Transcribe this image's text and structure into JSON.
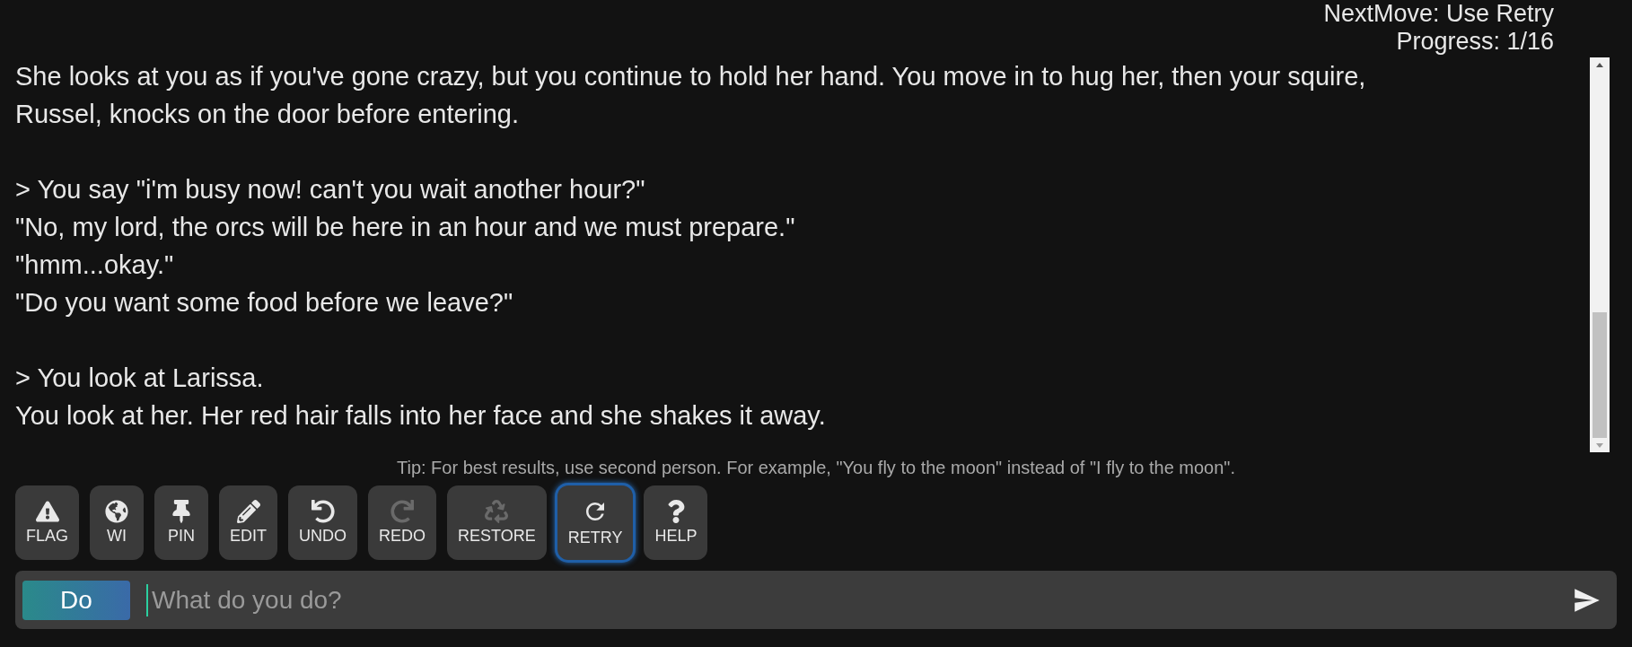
{
  "status": {
    "next_move": "NextMove: Use Retry",
    "progress": "Progress: 1/16"
  },
  "story": [
    {
      "kind": "text",
      "text": "She looks at you as if you've gone crazy, but you continue to hold her hand. You move in to hug her, then your squire, Russel, knocks on the door before entering."
    },
    {
      "kind": "gap"
    },
    {
      "kind": "text",
      "text": "> You say \"i'm busy now! can't you wait another hour?\""
    },
    {
      "kind": "text",
      "text": "\"No, my lord, the orcs will be here in an hour and we must prepare.\""
    },
    {
      "kind": "text",
      "text": "\"hmm...okay.\""
    },
    {
      "kind": "text",
      "text": "\"Do you want some food before we leave?\""
    },
    {
      "kind": "gap"
    },
    {
      "kind": "text",
      "text": "> You look at Larissa."
    },
    {
      "kind": "text",
      "text": "You look at her. Her red hair falls into her face and she shakes it away."
    }
  ],
  "tip": "Tip: For best results, use second person. For example, \"You fly to the moon\" instead of \"I fly to the moon\".",
  "buttons": [
    {
      "label": "FLAG",
      "disabled": false,
      "focused": false
    },
    {
      "label": "WI",
      "disabled": false,
      "focused": false
    },
    {
      "label": "PIN",
      "disabled": false,
      "focused": false
    },
    {
      "label": "EDIT",
      "disabled": false,
      "focused": false
    },
    {
      "label": "UNDO",
      "disabled": false,
      "focused": false
    },
    {
      "label": "REDO",
      "disabled": true,
      "focused": false
    },
    {
      "label": "RESTORE",
      "disabled": true,
      "focused": false
    },
    {
      "label": "RETRY",
      "disabled": false,
      "focused": true
    },
    {
      "label": "HELP",
      "disabled": false,
      "focused": false
    }
  ],
  "input": {
    "mode": "Do",
    "placeholder": "What do you do?"
  }
}
